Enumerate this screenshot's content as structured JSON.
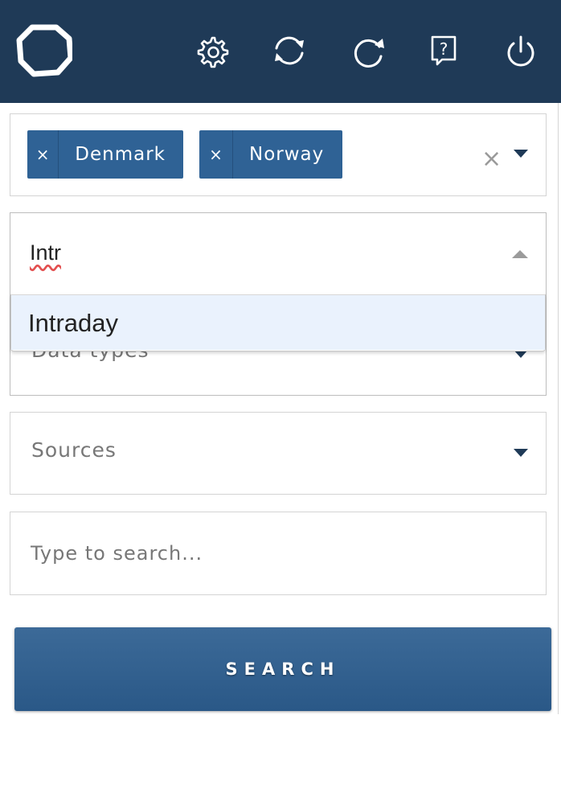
{
  "header": {
    "icons": [
      "logo-ring",
      "gear-icon",
      "sync-icon",
      "refresh-icon",
      "help-icon",
      "power-icon"
    ],
    "help_glyph": "?"
  },
  "countries": {
    "selected": [
      {
        "remove": "×",
        "label": "Denmark"
      },
      {
        "remove": "×",
        "label": "Norway"
      }
    ],
    "clear_glyph": "×"
  },
  "data_types": {
    "typed_value": "Intr",
    "placeholder": "Data types",
    "options": [
      "Intraday"
    ]
  },
  "sources": {
    "placeholder": "Sources"
  },
  "search": {
    "placeholder": "Type to search...",
    "value": "",
    "button_label": "SEARCH"
  },
  "colors": {
    "header_bg": "#1f3a57",
    "chip_bg": "#2f6295",
    "option_highlight": "#eaf2fd",
    "button_bg": "#2f5f8f"
  }
}
